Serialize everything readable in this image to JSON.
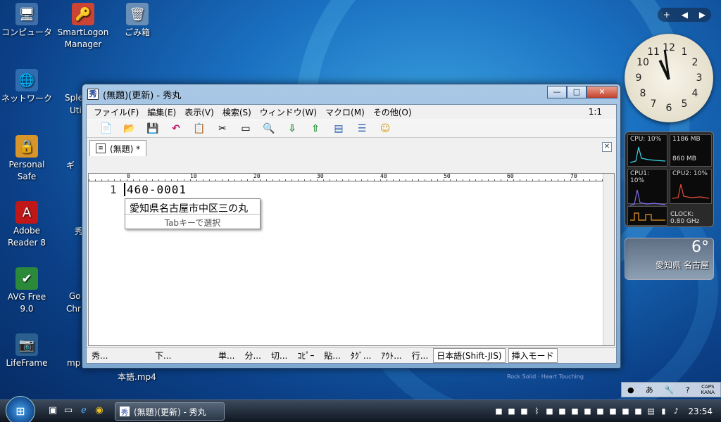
{
  "desktop": {
    "icons": [
      {
        "label": "コンピュータ",
        "glyph": "🖥"
      },
      {
        "label": "SmartLogon Manager",
        "glyph": "🔑"
      },
      {
        "label": "ごみ箱",
        "glyph": "🗑"
      },
      {
        "label": "ネットワーク",
        "glyph": "🌐"
      },
      {
        "label": "Personal Safe",
        "glyph": "🔒"
      },
      {
        "label": "Adobe Reader 8",
        "glyph": "A"
      },
      {
        "label": "AVG Free 9.0",
        "glyph": "✔"
      },
      {
        "label": "LifeFrame",
        "glyph": "📷"
      }
    ],
    "partial_labels": [
      "Sple",
      "Uti",
      "ギ",
      "秀",
      "Go",
      "Chr",
      "mp",
      "本語.mp4"
    ],
    "brand_text": "Rock Solid · Heart Touching"
  },
  "window": {
    "title": "(無題)(更新) - 秀丸",
    "app_icon_glyph": "秀",
    "buttons": {
      "minimize": "—",
      "maximize": "□",
      "close": "✕"
    },
    "menus": [
      "ファイル(F)",
      "編集(E)",
      "表示(V)",
      "検索(S)",
      "ウィンドウ(W)",
      "マクロ(M)",
      "その他(O)"
    ],
    "position_indicator": "1:1",
    "toolbar_icons": [
      "📄",
      "📂",
      "💾",
      "↶",
      "📋",
      "✂",
      "▭",
      "🔍",
      "⇩",
      "⇧",
      "▤",
      "☰",
      "☺"
    ],
    "tab_label": "(無題) *",
    "ruler_marks": [
      "0",
      "10",
      "20",
      "30",
      "40",
      "50",
      "60",
      "70"
    ],
    "line_number": "1",
    "line_text": "460-0001",
    "suggestion": "愛知県名古屋市中区三の丸",
    "suggestion_hint": "Tabキーで選択",
    "status": [
      "秀...",
      "下...",
      "単...",
      "分...",
      "切...",
      "ｺﾋﾟｰ",
      "貼...",
      "ﾀｸﾞ...",
      "ｱｳﾄ...",
      "行..."
    ],
    "encoding": "日本語(Shift-JIS)",
    "mode": "挿入モード"
  },
  "gadgets": {
    "bar": {
      "add": "+",
      "prev": "◀",
      "next": "▶"
    },
    "clock_numbers": [
      "12",
      "1",
      "2",
      "3",
      "4",
      "5",
      "6",
      "7",
      "8",
      "9",
      "10",
      "11"
    ],
    "cpu": {
      "cpu": "CPU:  10%",
      "mem1": "1186 MB",
      "mem2": "860 MB",
      "cpu1": "CPU1:  10%",
      "cpu2": "CPU2:  10%",
      "clock_label": "CLOCK:",
      "clock_value": "0.80 GHz"
    },
    "weather": {
      "temp": "6°",
      "city": "愛知県 名古屋"
    },
    "langbar": {
      "caps": "CAPS",
      "kana": "KANA",
      "ime": "あ"
    }
  },
  "taskbar": {
    "start_glyph": "⊞",
    "task_label": "(無題)(更新) - 秀丸",
    "time": "23:54"
  }
}
